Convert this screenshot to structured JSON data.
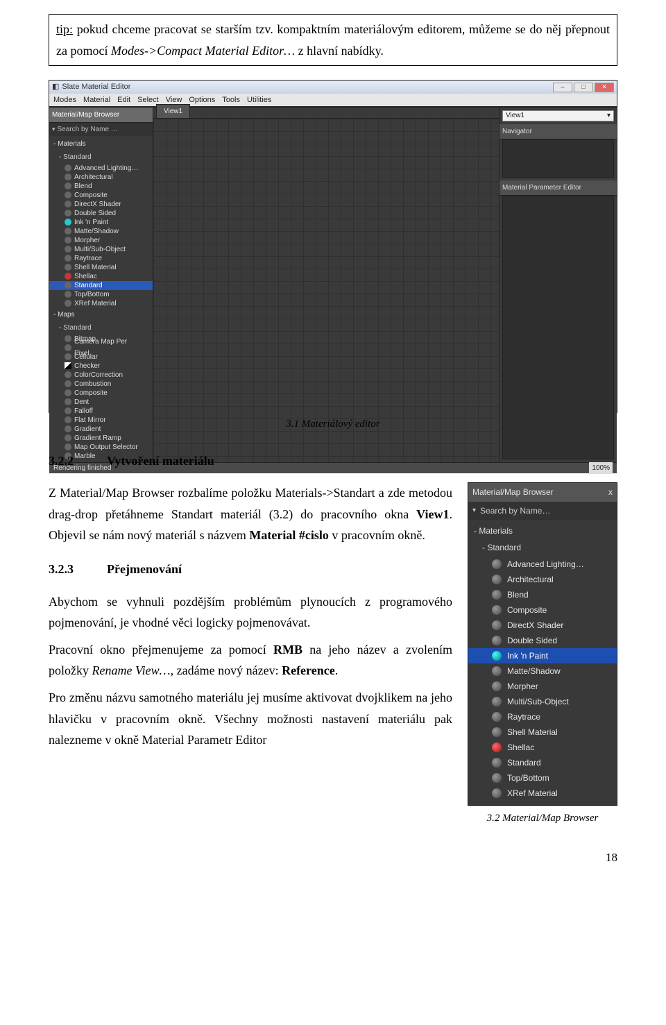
{
  "tip": {
    "label": "tip:",
    "text_a": " pokud chceme pracovat se starším tzv. kompaktním materiálovým editorem, můžeme se do něj přepnout za pomocí ",
    "menu": "Modes->Compact Material Editor…",
    "text_b": "  z  hlavní nabídky."
  },
  "slate": {
    "title": "Slate Material Editor",
    "menu": [
      "Modes",
      "Material",
      "Edit",
      "Select",
      "View",
      "Options",
      "Tools",
      "Utilities"
    ],
    "browser_header": "Material/Map Browser",
    "search_placeholder": "Search by Name …",
    "view_tab": "View1",
    "view_dd": "View1",
    "navigator": "Navigator",
    "param_editor": "Material Parameter Editor",
    "status": "Rendering finished",
    "zoom": "100%",
    "materials_group": "- Materials",
    "materials_sub": "- Standard",
    "materials": [
      {
        "label": "Advanced Lighting…",
        "cls": ""
      },
      {
        "label": "Architectural",
        "cls": ""
      },
      {
        "label": "Blend",
        "cls": ""
      },
      {
        "label": "Composite",
        "cls": ""
      },
      {
        "label": "DirectX Shader",
        "cls": ""
      },
      {
        "label": "Double Sided",
        "cls": ""
      },
      {
        "label": "Ink 'n Paint",
        "cls": "cyan"
      },
      {
        "label": "Matte/Shadow",
        "cls": ""
      },
      {
        "label": "Morpher",
        "cls": ""
      },
      {
        "label": "Multi/Sub-Object",
        "cls": ""
      },
      {
        "label": "Raytrace",
        "cls": ""
      },
      {
        "label": "Shell Material",
        "cls": ""
      },
      {
        "label": "Shellac",
        "cls": "red"
      },
      {
        "label": "Standard",
        "cls": "",
        "sel": true
      },
      {
        "label": "Top/Bottom",
        "cls": ""
      },
      {
        "label": "XRef Material",
        "cls": ""
      }
    ],
    "maps_group": "- Maps",
    "maps_sub": "- Standard",
    "maps": [
      {
        "label": "Bitmap",
        "cls": ""
      },
      {
        "label": "Camera Map Per Pixel",
        "cls": ""
      },
      {
        "label": "Cellular",
        "cls": ""
      },
      {
        "label": "Checker",
        "cls": "sq"
      },
      {
        "label": "ColorCorrection",
        "cls": ""
      },
      {
        "label": "Combustion",
        "cls": ""
      },
      {
        "label": "Composite",
        "cls": ""
      },
      {
        "label": "Dent",
        "cls": ""
      },
      {
        "label": "Falloff",
        "cls": ""
      },
      {
        "label": "Flat Mirror",
        "cls": ""
      },
      {
        "label": "Gradient",
        "cls": ""
      },
      {
        "label": "Gradient Ramp",
        "cls": ""
      },
      {
        "label": "Map Output Selector",
        "cls": ""
      },
      {
        "label": "Marble",
        "cls": ""
      }
    ]
  },
  "fig31_caption": "3.1 Materiálový editor",
  "sec322": {
    "num": "3.2.2",
    "title": "Vytvoření materiálu"
  },
  "p322": "Z Material/Map Browser rozbalíme položku Materials->Standart a zde metodou drag-drop přetáhneme Standart materiál (3.2) do pracovního okna View1. Objevil se nám nový materiál s názvem Material #cislo v pracovním okně.",
  "sec323": {
    "num": "3.2.3",
    "title": "Přejmenování"
  },
  "p323a": "Abychom se vyhnuli pozdějším problémům plynoucích z programového pojmenování, je vhodné věci logicky pojmenovávat.",
  "p323b_a": "Pracovní okno přejmenujeme za pomocí ",
  "p323b_rmb": "RMB",
  "p323b_b": " na jeho název a zvolením položky ",
  "p323b_rename": "Rename View…",
  "p323b_c": ", zadáme nový název: ",
  "p323b_ref": "Reference",
  "p323b_d": ".",
  "p323c": " Pro změnu názvu samotného materiálu jej musíme aktivovat dvojklikem na jeho hlavičku v pracovním okně. Všechny možnosti nastavení materiálu pak nalezneme v okně Material Parametr Editor",
  "mmb": {
    "title": "Material/Map Browser",
    "close": "x",
    "search": "Search by Name…",
    "group": "- Materials",
    "sub": "- Standard",
    "items": [
      {
        "label": "Advanced Lighting…",
        "cls": ""
      },
      {
        "label": "Architectural",
        "cls": ""
      },
      {
        "label": "Blend",
        "cls": ""
      },
      {
        "label": "Composite",
        "cls": ""
      },
      {
        "label": "DirectX Shader",
        "cls": ""
      },
      {
        "label": "Double Sided",
        "cls": ""
      },
      {
        "label": "Ink 'n Paint",
        "cls": "cyan",
        "sel": true
      },
      {
        "label": "Matte/Shadow",
        "cls": ""
      },
      {
        "label": "Morpher",
        "cls": ""
      },
      {
        "label": "Multi/Sub-Object",
        "cls": ""
      },
      {
        "label": "Raytrace",
        "cls": ""
      },
      {
        "label": "Shell Material",
        "cls": ""
      },
      {
        "label": "Shellac",
        "cls": "red"
      },
      {
        "label": "Standard",
        "cls": ""
      },
      {
        "label": "Top/Bottom",
        "cls": ""
      },
      {
        "label": "XRef Material",
        "cls": ""
      }
    ]
  },
  "fig32_caption": "3.2 Material/Map Browser",
  "page_num": "18"
}
